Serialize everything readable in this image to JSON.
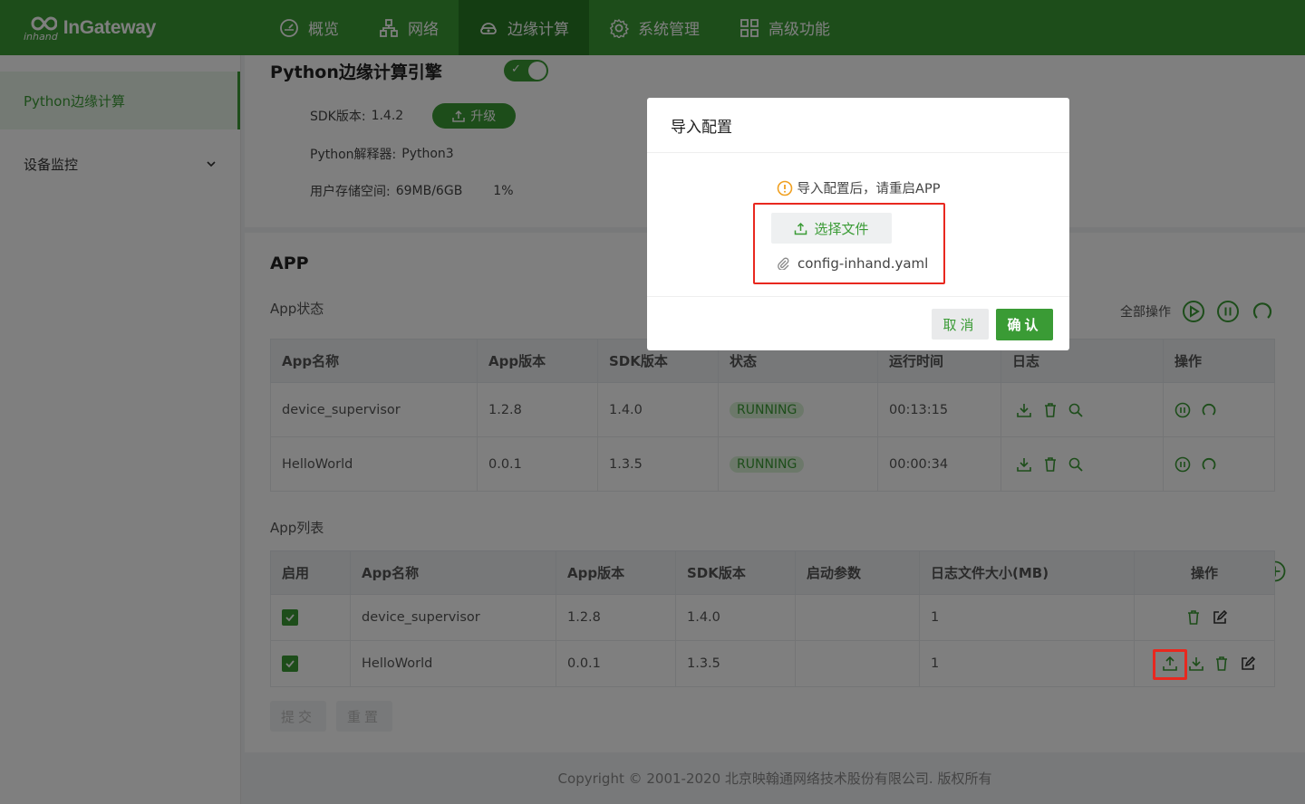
{
  "app": {
    "logo_text": "InGateway",
    "logo_sub": "inhand"
  },
  "nav": {
    "items": [
      {
        "label": "概览",
        "icon": "dashboard-icon"
      },
      {
        "label": "网络",
        "icon": "network-icon"
      },
      {
        "label": "边缘计算",
        "icon": "edge-computing-icon",
        "active": true
      },
      {
        "label": "系统管理",
        "icon": "gear-icon"
      },
      {
        "label": "高级功能",
        "icon": "grid-icon"
      }
    ]
  },
  "sidebar": {
    "items": [
      {
        "label": "Python边缘计算",
        "active": true
      },
      {
        "label": "设备监控",
        "expandable": true
      }
    ]
  },
  "engine": {
    "title": "Python边缘计算引擎",
    "enabled": true,
    "sdk_label": "SDK版本:",
    "sdk_value": "1.4.2",
    "upgrade_label": "升级",
    "interpreter_label": "Python解释器:",
    "interpreter_value": "Python3",
    "storage_label": "用户存储空间:",
    "storage_value": "69MB/6GB",
    "storage_percent": "1%"
  },
  "app_section": {
    "title": "APP",
    "status_label": "App状态",
    "all_ops_label": "全部操作",
    "status_table": {
      "headers": [
        "App名称",
        "App版本",
        "SDK版本",
        "状态",
        "运行时间",
        "日志",
        "操作"
      ],
      "rows": [
        {
          "name": "device_supervisor",
          "version": "1.2.8",
          "sdk": "1.4.0",
          "status": "RUNNING",
          "uptime": "00:13:15"
        },
        {
          "name": "HelloWorld",
          "version": "0.0.1",
          "sdk": "1.3.5",
          "status": "RUNNING",
          "uptime": "00:00:34"
        }
      ]
    },
    "list_label": "App列表",
    "list_table": {
      "headers": [
        "启用",
        "App名称",
        "App版本",
        "SDK版本",
        "启动参数",
        "日志文件大小(MB)",
        "操作"
      ],
      "rows": [
        {
          "enabled": true,
          "name": "device_supervisor",
          "version": "1.2.8",
          "sdk": "1.4.0",
          "params": "",
          "log_size": "1"
        },
        {
          "enabled": true,
          "name": "HelloWorld",
          "version": "0.0.1",
          "sdk": "1.3.5",
          "params": "",
          "log_size": "1"
        }
      ]
    },
    "submit_label": "提交",
    "reset_label": "重置"
  },
  "footer": {
    "text": "Copyright © 2001-2020 北京映翰通网络技术股份有限公司. 版权所有"
  },
  "modal": {
    "title": "导入配置",
    "warning": "导入配置后，请重启APP",
    "choose_file_label": "选择文件",
    "file_name": "config-inhand.yaml",
    "cancel_label": "取消",
    "ok_label": "确认"
  },
  "colors": {
    "brand": "#3a9b35",
    "highlight": "#e8281f"
  }
}
